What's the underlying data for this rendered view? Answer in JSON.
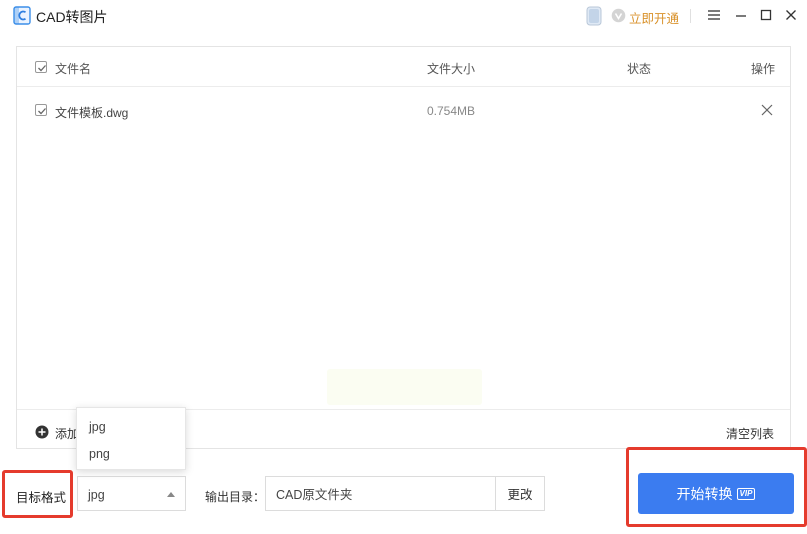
{
  "app": {
    "title": "CAD转图片"
  },
  "header": {
    "vip_link": "立即开通"
  },
  "table": {
    "columns": {
      "name": "文件名",
      "size": "文件大小",
      "status": "状态",
      "action": "操作"
    },
    "rows": [
      {
        "name": "文件模板.dwg",
        "size": "0.754MB",
        "status": ""
      }
    ]
  },
  "footer": {
    "add_label": "添加",
    "clear_label": "清空列表"
  },
  "format": {
    "label": "目标格式",
    "selected": "jpg",
    "options": [
      "jpg",
      "png"
    ]
  },
  "output": {
    "label": "输出目录：",
    "path": "CAD原文件夹",
    "change_label": "更改"
  },
  "start": {
    "label": "开始转换",
    "badge": "VIP"
  },
  "colors": {
    "accent": "#3b7cf0",
    "highlight": "#e53b2d",
    "vip": "#d9922b"
  }
}
